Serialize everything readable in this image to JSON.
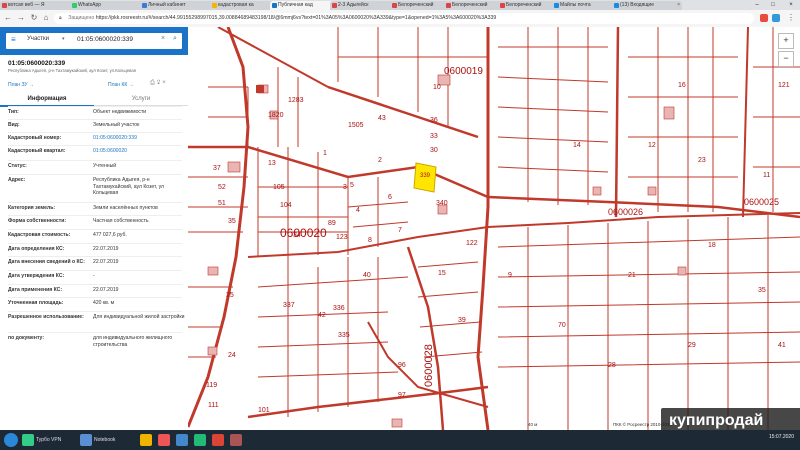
{
  "browser": {
    "tabs": [
      {
        "label": "вотсап веб — Я"
      },
      {
        "label": "WhatsApp"
      },
      {
        "label": "Личный кабинет"
      },
      {
        "label": "кадастровая ка"
      },
      {
        "label": "Публичная кад"
      },
      {
        "label": "2-3 Адыгейск"
      },
      {
        "label": "Белореченский"
      },
      {
        "label": "Белореченский"
      },
      {
        "label": "Белореченский"
      },
      {
        "label": "Майлы почта"
      },
      {
        "label": "(13) Входящие"
      }
    ],
    "security_label": "Защищено",
    "url": "https://pkk.rosreestr.ru/#/search/44.99155298997015,39.00884689483198/18/@6mmj6vs?text=01%3A05%3A0600020%3A339&type=1&opened=1%3A5%3A600020%3A339"
  },
  "panel": {
    "search": {
      "mode": "Участки",
      "query": "01:05:0600020:339"
    },
    "object": {
      "title": "01:05:0600020:339",
      "address": "Республика Адыгея, р-н Тахтамукайский, аул Козет, ул.Кольцевая"
    },
    "plan_links": [
      "План ЗУ →",
      "План КК →"
    ],
    "tabs": [
      "Информация",
      "Услуги"
    ],
    "attributes": [
      {
        "label": "Тип:",
        "value": "Объект недвижимости",
        "link": false
      },
      {
        "label": "Вид:",
        "value": "Земельный участок",
        "link": false
      },
      {
        "label": "Кадастровый номер:",
        "value": "01:05:0600020:339",
        "link": true
      },
      {
        "label": "Кадастровый квартал:",
        "value": "01:05:0600020",
        "link": true
      },
      {
        "label": "Статус:",
        "value": "Учтенный",
        "link": false
      },
      {
        "label": "Адрес:",
        "value": "Республика Адыгея, р-н Тахтамукайский, аул Козет, ул Кольцевая",
        "link": false
      },
      {
        "label": "Категория земель:",
        "value": "Земли населённых пунктов",
        "link": false
      },
      {
        "label": "Форма собственности:",
        "value": "Частная собственность",
        "link": false
      },
      {
        "label": "Кадастровая стоимость:",
        "value": "477 027,6 руб.",
        "link": false
      },
      {
        "label": "Дата определения КС:",
        "value": "22.07.2019",
        "link": false
      },
      {
        "label": "Дата внесения сведений о КС:",
        "value": "22.07.2019",
        "link": false
      },
      {
        "label": "Дата утверждения КС:",
        "value": "-",
        "link": false
      },
      {
        "label": "Дата применения КС:",
        "value": "22.07.2019",
        "link": false
      },
      {
        "label": "Уточненная площадь:",
        "value": "420 кв. м",
        "link": false
      },
      {
        "label": "Разрешенное использование:",
        "value": "Для индивидуальной жилой застройки",
        "link": false
      },
      {
        "label": "по документу:",
        "value": "для индивидуального жилищного строительства",
        "link": false
      }
    ]
  },
  "map": {
    "quarter_labels": [
      "0600020",
      "0600019",
      "0600026",
      "0600025",
      "0600028"
    ],
    "parcel_labels": [
      "37",
      "13",
      "1",
      "3",
      "105",
      "104",
      "52",
      "51",
      "35",
      "2",
      "6",
      "4",
      "5",
      "7",
      "8",
      "34",
      "89",
      "123",
      "15",
      "40",
      "336",
      "42",
      "25",
      "24",
      "119",
      "111",
      "101",
      "337",
      "335",
      "96",
      "97",
      "1283",
      "1820",
      "1505",
      "43",
      "36",
      "33",
      "30",
      "10",
      "339",
      "340",
      "122",
      "14",
      "12",
      "16",
      "23",
      "18",
      "21",
      "39",
      "29",
      "121",
      "11",
      "9",
      "35",
      "70",
      "41",
      "28"
    ],
    "highlighted_parcel": "339",
    "scale_label": "40 м",
    "copyright": "ПКК © Росреестр 2010-2020"
  },
  "watermark": "купипродай",
  "taskbar": {
    "items": [
      {
        "label": "Турбо VPN"
      },
      {
        "label": "Notebook"
      }
    ],
    "time": "15:07.2020"
  },
  "colors": {
    "accent": "#1a73c6",
    "parcel_line": "#c0392b",
    "highlight": "#ffe500"
  }
}
